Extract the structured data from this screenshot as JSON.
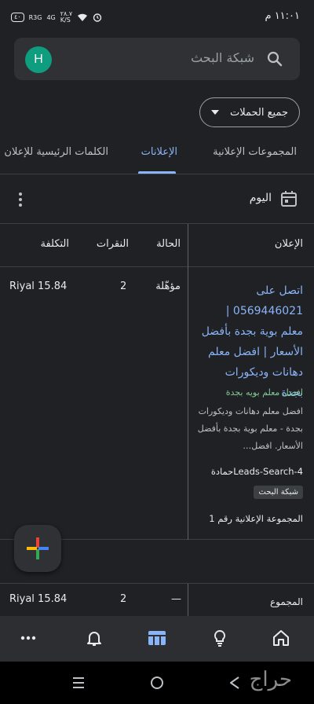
{
  "status_bar": {
    "time": "١١:٠١ م",
    "network_speed": "٢٨.٧\nK/S",
    "signal_label_1": "R3G",
    "signal_label_2": "4G",
    "battery": "٤٠"
  },
  "search": {
    "placeholder": "شبكة البحث",
    "avatar_letter": "H"
  },
  "campaign_filter": {
    "label": "جميع الحملات"
  },
  "tabs": [
    {
      "label": "المجموعات الإعلانية",
      "active": false
    },
    {
      "label": "الإعلانات",
      "active": true
    },
    {
      "label": "الكلمات الرئيسية للإعلان",
      "active": false
    }
  ],
  "date_range": {
    "label": "اليوم"
  },
  "table": {
    "headers": {
      "ad": "الإعلان",
      "status": "الحالة",
      "clicks": "النقرات",
      "cost": "التكلفة"
    },
    "rows": [
      {
        "headline": "اتصل على 0569446021 | معلم بوية بجدة بأفضل الأسعار | افضل معلم دهانات وديكورات بجدة",
        "display_url": "افضل معلم بويه بجدة",
        "description": "افضل معلم دهانات وديكورات بجدة - معلم بوية بجدة بأفضل الأسعار. افضل…",
        "campaign": "Leads-Search-4حمادة",
        "network_badge": "شبكة البحث",
        "ad_group": "المجموعة الإعلانية رقم 1",
        "status": "مؤهّلة",
        "clicks": "2",
        "cost": "Riyal 15.84"
      }
    ],
    "total": {
      "label": "المجموع",
      "status": "—",
      "clicks": "2",
      "cost": "Riyal 15.84"
    }
  },
  "bottom_nav": {
    "items": [
      "home-icon",
      "lightbulb-icon",
      "table-icon",
      "bell-icon",
      "more-icon"
    ],
    "active": "table-icon"
  },
  "watermark": "حراج",
  "colors": {
    "background": "#202124",
    "accent": "#8ab4f8",
    "url_green": "#81c995",
    "avatar": "#0f9d7f"
  }
}
